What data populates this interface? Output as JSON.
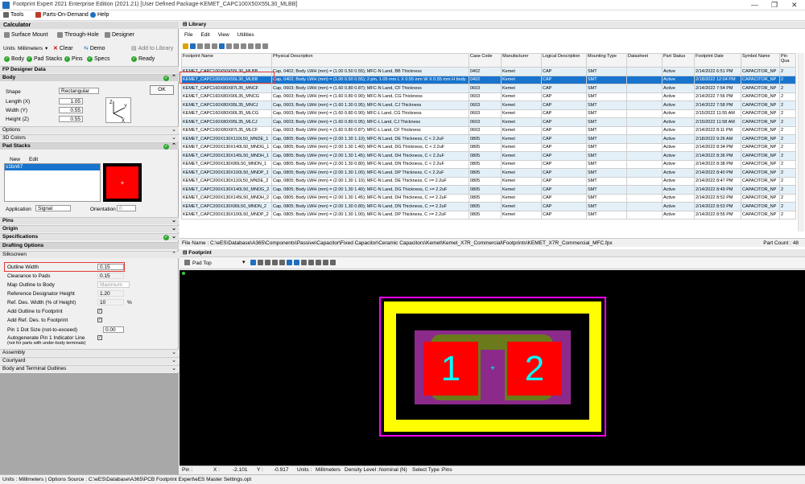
{
  "window": {
    "title": "Footprint Expert 2021 Enterprise Edition (2021.21) [User Defined Package-KEMET_CAPC100X50X55L30_MLBB]",
    "min": "—",
    "max": "❐",
    "close": "✕"
  },
  "menu": {
    "tools": "Tools",
    "pod": "Parts-On-Demand",
    "help": "Help"
  },
  "calc": {
    "title": "Calculator",
    "tabs": {
      "surface": "Surface Mount",
      "through": "Through-Hole",
      "designer": "Designer"
    },
    "units_label": "Units",
    "units_value": "Millimeters",
    "clear": "Clear",
    "demo": "Demo",
    "add_lib": "Add to Library",
    "status": {
      "body": "Body",
      "pad_stacks": "Pad Stacks",
      "pins": "Pins",
      "specs": "Specs",
      "ready": "Ready"
    }
  },
  "fp_designer": {
    "title": "FP Designer Data",
    "body_title": "Body",
    "shape_label": "Shape",
    "shape_value": "Rectangular",
    "ok": "OK",
    "length_label": "Length (X)",
    "length": "1.05",
    "width_label": "Width (Y)",
    "width": "0.55",
    "height_label": "Height (Z)",
    "height": "0.55",
    "options": "Options",
    "colors3d": "3D Colors",
    "pad_stacks": "Pad Stacks",
    "new": "New",
    "edit": "Edit",
    "pad_item": "s1bn67",
    "application_label": "Application",
    "application": "Signal",
    "orientation_label": "Orientation",
    "orientation": "0",
    "pins": "Pins",
    "origin": "Origin",
    "specs": "Specifications"
  },
  "drafting": {
    "title": "Drafting Options",
    "silkscreen": "Silkscreen",
    "outline_width_label": "Outline Width",
    "outline_width": "0.15",
    "clearance_label": "Clearance to Pads",
    "clearance": "0.15",
    "map_label": "Map Outline to Body",
    "map_value": "Maximum",
    "ref_height_label": "Reference Designator Height",
    "ref_height": "1.20",
    "ref_width_label": "Ref. Des. Width (% of Height)",
    "ref_width": "10",
    "ref_width_unit": "%",
    "add_outline_label": "Add Outline to Footprint",
    "add_ref_label": "Add Ref. Des. to Footprint",
    "dot_label": "Pin 1 Dot Size (not-to-exceed)",
    "dot": "0.00",
    "autogen_label": "Autogenerate Pin 1 Indicator Line",
    "autogen_sub": "(not for parts with under-body terminals)",
    "assembly": "Assembly",
    "courtyard": "Courtyard",
    "terminal": "Body and Terminal Outlines"
  },
  "library": {
    "title": "Library",
    "menu": [
      "File",
      "Edit",
      "View",
      "Utilities"
    ],
    "columns": [
      "Footprint Name",
      "Physical Description",
      "Case Code",
      "Manufacturer",
      "Logical Description",
      "Mounting Type",
      "Datasheet",
      "Part Status",
      "Footprint Date",
      "Symbol Name",
      "Pin Qua"
    ],
    "rows": [
      [
        "KEMET_CAPC100X50X55L30_MLBB",
        "Cap, 0402; Body LWH (mm) = (1.00 0.50 0.55); MFC-N Land, BB Thickness",
        "0402",
        "Kemet",
        "CAP",
        "SMT",
        "",
        "Active",
        "2/14/2022 6:51 PM",
        "CAPACITOR_NP",
        "2"
      ],
      [
        "KEMET_CAPC100X50X55L30_MLBB",
        "Cap, 0402; Body LWH (mm) = (1.00 0.50 0.55); 2 pin, 1.05 mm L X 0.55 mm W X 0.55 mm H body",
        "0402",
        "Kemet",
        "CAP",
        "SMT",
        "",
        "Active",
        "2/18/2022 12:04 PM",
        "CAPACITOR_NP",
        "2"
      ],
      [
        "KEMET_CAPC160X80X87L35_MNCF",
        "Cap, 0603; Body LWH (mm) = (1.60 0.80 0.87); MFC-N Land, CF Thickness",
        "0603",
        "Kemet",
        "CAP",
        "SMT",
        "",
        "Active",
        "2/14/2022 7:54 PM",
        "CAPACITOR_NP",
        "2"
      ],
      [
        "KEMET_CAPC160X80X90L35_MNCG",
        "Cap, 0603; Body LWH (mm) = (1.60 0.80 0.90); MFC-N Land, CG Thickness",
        "0603",
        "Kemet",
        "CAP",
        "SMT",
        "",
        "Active",
        "2/14/2022 7:56 PM",
        "CAPACITOR_NP",
        "2"
      ],
      [
        "KEMET_CAPC160X80X95L35_MNCJ",
        "Cap, 0603; Body LWH (mm) = (1.60 1.30 0.95); MFC-N Land, CJ Thickness",
        "0603",
        "Kemet",
        "CAP",
        "SMT",
        "",
        "Active",
        "2/14/2022 7:58 PM",
        "CAPACITOR_NP",
        "2"
      ],
      [
        "KEMET_CAPC160X80X90L35_MLCG",
        "Cap, 0603; Body LWH (mm) = (1.60 0.80 0.90); MFC-L Land, CG Thickness",
        "0603",
        "Kemet",
        "CAP",
        "SMT",
        "",
        "Active",
        "2/15/2022 11:55 AM",
        "CAPACITOR_NP",
        "2"
      ],
      [
        "KEMET_CAPC160X80X95L35_MLCJ",
        "Cap, 0603; Body LWH (mm) = (1.60 0.80 0.95); MFC-L Land, CJ Thickness",
        "0603",
        "Kemet",
        "CAP",
        "SMT",
        "",
        "Active",
        "2/15/2022 11:58 AM",
        "CAPACITOR_NP",
        "2"
      ],
      [
        "KEMET_CAPC160X80X87L35_MLCF",
        "Cap, 0603; Body LWH (mm) = (1.60 0.80 0.87); MFC-L Land, CF Thickness",
        "0603",
        "Kemet",
        "CAP",
        "SMT",
        "",
        "Active",
        "2/14/2022 8:11 PM",
        "CAPACITOR_NP",
        "2"
      ],
      [
        "KEMET_CAPC200X130X110L50_MNDE_1",
        "Cap, 0805; Body LWH (mm) = (2.00 1.30 1.10); MFC-N Land, DE Thickness, C < 2.2uF",
        "0805",
        "Kemet",
        "CAP",
        "SMT",
        "",
        "Active",
        "2/18/2022 9:26 AM",
        "CAPACITOR_NP",
        "2"
      ],
      [
        "KEMET_CAPC200X130X140L50_MNDG_1",
        "Cap, 0805; Body LWH (mm) = (2.00 1.30 1.40); MFC-N Land, DG Thickness, C < 2.2uF",
        "0805",
        "Kemet",
        "CAP",
        "SMT",
        "",
        "Active",
        "2/14/2022 8:34 PM",
        "CAPACITOR_NP",
        "2"
      ],
      [
        "KEMET_CAPC200X130X145L50_MNDH_1",
        "Cap, 0805; Body LWH (mm) = (2.00 1.30 1.45); MFC-N Land, DH Thickness, C < 2.2uF",
        "0805",
        "Kemet",
        "CAP",
        "SMT",
        "",
        "Active",
        "2/14/2022 8:36 PM",
        "CAPACITOR_NP",
        "2"
      ],
      [
        "KEMET_CAPC200X130X80L50_MNDN_1",
        "Cap, 0805; Body LWH (mm) = (2.00 1.30 0.80); MFC-N Land, DN Thickness, C < 2.2uF",
        "0805",
        "Kemet",
        "CAP",
        "SMT",
        "",
        "Active",
        "2/14/2022 8:38 PM",
        "CAPACITOR_NP",
        "2"
      ],
      [
        "KEMET_CAPC200X130X100L50_MNDP_1",
        "Cap, 0805; Body LWH (mm) = (2.00 1.30 1.00); MFC-N Land, DP Thickness, C < 2.2uF",
        "0805",
        "Kemet",
        "CAP",
        "SMT",
        "",
        "Active",
        "2/14/2022 8:40 PM",
        "CAPACITOR_NP",
        "2"
      ],
      [
        "KEMET_CAPC200X130X110L50_MNDE_2",
        "Cap, 0805; Body LWH (mm) = (2.00 1.30 1.10); MFC-N Land, DE Thickness, C >= 2.2uF",
        "0805",
        "Kemet",
        "CAP",
        "SMT",
        "",
        "Active",
        "2/14/2022 8:47 PM",
        "CAPACITOR_NP",
        "2"
      ],
      [
        "KEMET_CAPC200X130X140L50_MNDG_2",
        "Cap, 0805; Body LWH (mm) = (2.00 1.30 1.40); MFC-N Land, DG Thickness, C >= 2.2uF",
        "0805",
        "Kemet",
        "CAP",
        "SMT",
        "",
        "Active",
        "2/14/2022 8:49 PM",
        "CAPACITOR_NP",
        "2"
      ],
      [
        "KEMET_CAPC200X130X145L50_MNDH_2",
        "Cap, 0805; Body LWH (mm) = (2.00 1.30 1.45); MFC-N Land, DH Thickness, C >= 2.2uF",
        "0805",
        "Kemet",
        "CAP",
        "SMT",
        "",
        "Active",
        "2/14/2022 8:52 PM",
        "CAPACITOR_NP",
        "2"
      ],
      [
        "KEMET_CAPC200X130X80L50_MNDN_2",
        "Cap, 0805; Body LWH (mm) = (2.00 1.30 0.80); MFC-N Land, DN Thickness, C >= 2.2uF",
        "0805",
        "Kemet",
        "CAP",
        "SMT",
        "",
        "Active",
        "2/14/2022 8:53 PM",
        "CAPACITOR_NP",
        "2"
      ],
      [
        "KEMET_CAPC200X130X100L50_MNDP_2",
        "Cap, 0805; Body LWH (mm) = (2.00 1.30 1.00); MFC-N Land, DP Thickness, C >= 2.2uF",
        "0805",
        "Kemet",
        "CAP",
        "SMT",
        "",
        "Active",
        "2/14/2022 8:55 PM",
        "CAPACITOR_NP",
        "2"
      ]
    ],
    "file_label": "File Name :",
    "file_path": "C:\\eES\\Database\\A365\\Components\\Passive\\Capacitor\\Fixed Capacitor\\Ceramic Capacitors\\Kemet\\Kemet_X7R_Commercial\\Footprints\\KEMET_X7R_Commercial_MFC.fpx",
    "part_count_label": "Part Count :",
    "part_count": "48"
  },
  "footprint": {
    "title": "Footprint",
    "layer": "Pad Top",
    "pad1": "1",
    "pad2": "2"
  },
  "pinbar": {
    "pin_label": "Pin :",
    "x_label": "X :",
    "x": "-2.101",
    "y_label": "Y :",
    "y": "-0.917",
    "units_label": "Units :",
    "units": "Millimeters",
    "density_label": "Density Level :",
    "density": "Nominal (N)",
    "select_label": "Select Type :",
    "select": "Pins"
  },
  "statusbar": {
    "units_label": "Units :",
    "units": "Millimeters",
    "options_label": "Options Source :",
    "options": "C:\\eES\\Database\\A365\\PCB Footprint Expert\\eES Master Settings.opt"
  },
  "colors": {
    "accent": "#1874cd",
    "silk": "#ffff00",
    "courtyard": "#ff00ff",
    "pad": "#ff0000",
    "pad_text": "#00ffff",
    "body": "#8b2a8b",
    "assembly": "#6b7a1a",
    "ok_green": "#2ea62e",
    "highlight": "#e53935"
  }
}
